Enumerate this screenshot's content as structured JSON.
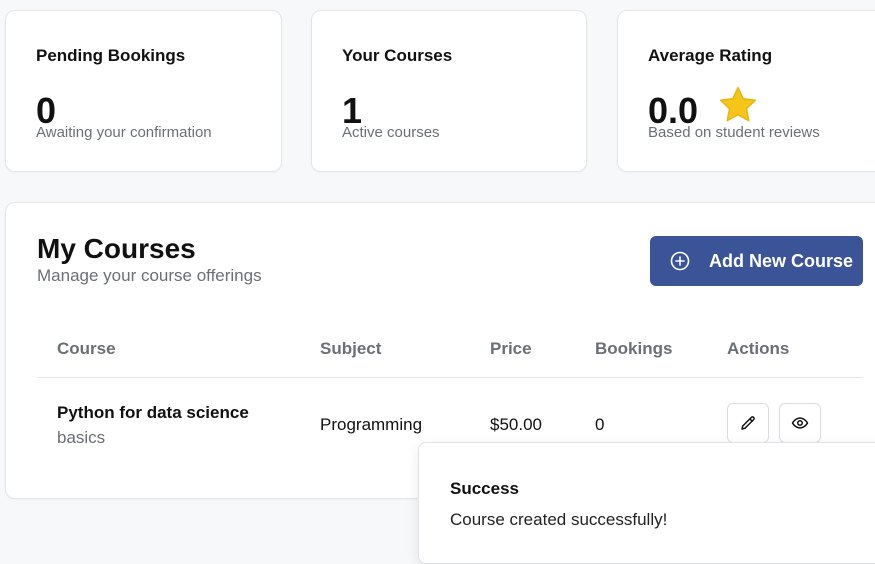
{
  "stats": {
    "pending": {
      "label": "Pending Bookings",
      "value": "0",
      "sub": "Awaiting your confirmation"
    },
    "courses": {
      "label": "Your Courses",
      "value": "1",
      "sub": "Active courses"
    },
    "rating": {
      "label": "Average Rating",
      "value": "0.0",
      "sub": "Based on student reviews",
      "icon": "star-icon",
      "icon_color": "#f5c518"
    }
  },
  "my_courses": {
    "title": "My Courses",
    "subtitle": "Manage your course offerings",
    "add_button": {
      "label": "Add New Course",
      "icon": "plus-circle-icon",
      "color": "#3b5497"
    },
    "columns": [
      "Course",
      "Subject",
      "Price",
      "Bookings",
      "Actions"
    ],
    "rows": [
      {
        "name_line1": "Python for data science",
        "name_line2": "basics",
        "subject": "Programming",
        "price": "$50.00",
        "bookings": "0",
        "actions": [
          "pencil-icon",
          "eye-icon"
        ]
      }
    ]
  },
  "toast": {
    "title": "Success",
    "message": "Course created successfully!"
  }
}
